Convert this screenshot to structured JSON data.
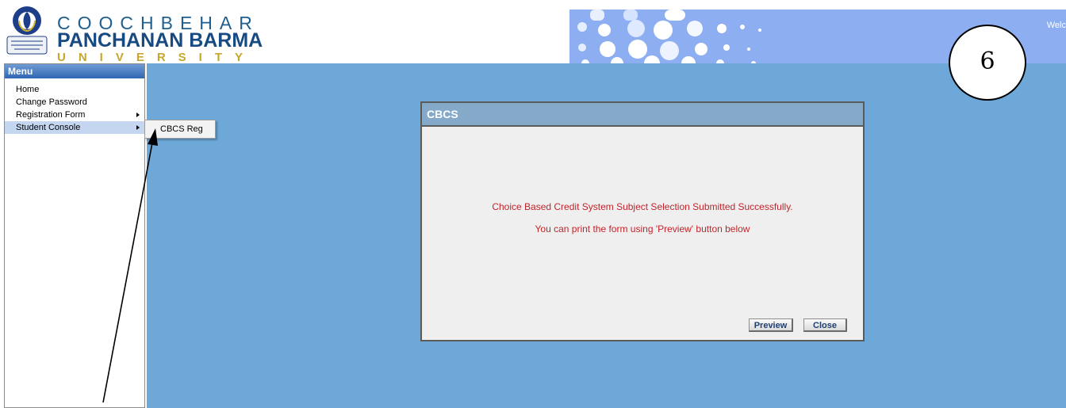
{
  "header": {
    "logo_line1": "COOCHBEHAR",
    "logo_line2": "PANCHANAN BARMA",
    "logo_line3": "UNIVERSITY",
    "welcome_text": "Welc"
  },
  "sidebar": {
    "title": "Menu",
    "items": [
      {
        "label": "Home",
        "has_submenu": false
      },
      {
        "label": "Change Password",
        "has_submenu": false
      },
      {
        "label": "Registration Form",
        "has_submenu": true
      },
      {
        "label": "Student Console",
        "has_submenu": true,
        "active": true
      }
    ]
  },
  "submenu": {
    "items": [
      {
        "label": "CBCS Reg"
      }
    ]
  },
  "dialog": {
    "title": "CBCS",
    "message_line1": "Choice Based Credit System Subject Selection Submitted Successfully.",
    "message_line2": "You can print the form using 'Preview' button below",
    "preview_label": "Preview",
    "close_label": "Close"
  },
  "annotation": {
    "step_number": "6"
  },
  "colors": {
    "content_bg": "#6da8d8",
    "banner_bg": "#8eaef2",
    "menu_header": "#2f67b3",
    "dialog_title_bg": "#85a9c9",
    "message_red": "#c0252c"
  }
}
